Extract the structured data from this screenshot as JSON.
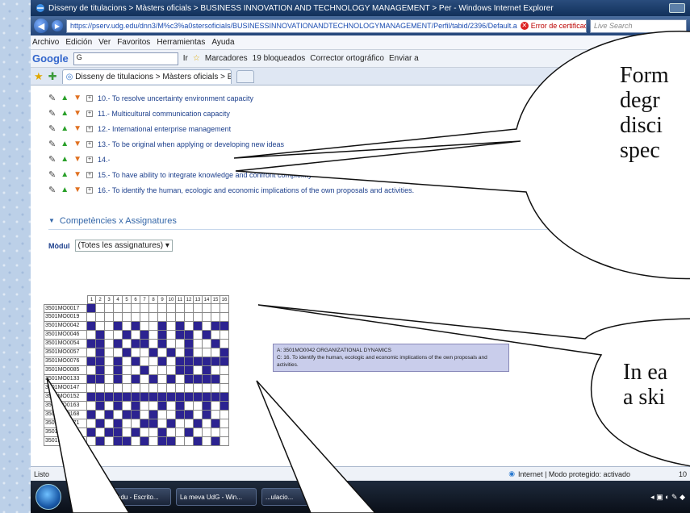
{
  "window": {
    "title": "Disseny de titulacions > Màsters oficials > BUSINESS INNOVATION AND TECHNOLOGY MANAGEMENT > Per - Windows Internet Explorer",
    "url": "https://pserv.udg.edu/dnn3/M%c3%a0stersoficials/BUSINESSINNOVATIONANDTECHNOLOGYMANAGEMENT/Perfil/tabid/2396/Default.a",
    "cert_error": "Error de certificado",
    "live_search": "Live Search"
  },
  "menu": [
    "Archivo",
    "Edición",
    "Ver",
    "Favoritos",
    "Herramientas",
    "Ayuda"
  ],
  "google_bar": {
    "logo": "Google",
    "search_value": "G",
    "go": "Ir",
    "bookmarks": "Marcadores",
    "blocked": "19 bloqueados",
    "spell": "Corrector ortográfico",
    "send": "Enviar a"
  },
  "tab": {
    "label": "Disseny de titulacions > Màsters oficials > BUSIN..."
  },
  "competences": [
    "10.- To resolve uncertainty environment capacity",
    "11.- Multicultural communication capacity",
    "12.- International enterprise management",
    "13.- To be original when applying or developing new ideas",
    "14.-",
    "15.- To have ability to integrate knowledge and confront complexity",
    "16.- To identify the human, ecologic and economic implications of the own proposals and activities."
  ],
  "section": {
    "title": "Competències x Assignatures"
  },
  "modul": {
    "label": "Mòdul",
    "value": "(Totes les assignatures)"
  },
  "matrix": {
    "columns": [
      "1",
      "2",
      "3",
      "4",
      "5",
      "6",
      "7",
      "8",
      "9",
      "10",
      "11",
      "12",
      "13",
      "14",
      "15",
      "16"
    ],
    "rows": [
      {
        "code": "3501MO0017",
        "cells": [
          1,
          0,
          0,
          0,
          0,
          0,
          0,
          0,
          0,
          0,
          0,
          0,
          0,
          0,
          0,
          0
        ]
      },
      {
        "code": "3501MO0019",
        "cells": [
          0,
          0,
          0,
          0,
          0,
          0,
          0,
          0,
          0,
          0,
          0,
          0,
          0,
          0,
          0,
          0
        ]
      },
      {
        "code": "3501MO0042",
        "cells": [
          1,
          0,
          0,
          1,
          0,
          1,
          0,
          0,
          1,
          0,
          1,
          0,
          1,
          0,
          1,
          1
        ]
      },
      {
        "code": "3501MO0046",
        "cells": [
          0,
          1,
          0,
          0,
          1,
          0,
          1,
          0,
          1,
          0,
          1,
          1,
          0,
          1,
          0,
          0
        ]
      },
      {
        "code": "3501MO0054",
        "cells": [
          1,
          1,
          0,
          1,
          0,
          1,
          1,
          0,
          1,
          0,
          0,
          1,
          0,
          0,
          1,
          0
        ]
      },
      {
        "code": "3501MO0057",
        "cells": [
          0,
          1,
          0,
          0,
          1,
          0,
          0,
          1,
          0,
          1,
          0,
          1,
          0,
          0,
          0,
          1
        ]
      },
      {
        "code": "3501MO0076",
        "cells": [
          1,
          1,
          0,
          1,
          0,
          1,
          0,
          0,
          1,
          0,
          1,
          1,
          1,
          1,
          1,
          1
        ]
      },
      {
        "code": "3501MO0085",
        "cells": [
          0,
          1,
          0,
          1,
          0,
          0,
          1,
          0,
          0,
          0,
          1,
          1,
          0,
          1,
          0,
          0
        ]
      },
      {
        "code": "3501MO0133",
        "cells": [
          1,
          1,
          0,
          1,
          0,
          1,
          0,
          1,
          0,
          1,
          0,
          1,
          1,
          1,
          1,
          0
        ]
      },
      {
        "code": "3501MO0147",
        "cells": [
          0,
          0,
          0,
          0,
          0,
          0,
          0,
          0,
          0,
          0,
          0,
          0,
          0,
          0,
          0,
          0
        ]
      },
      {
        "code": "3501MO0152",
        "cells": [
          1,
          1,
          1,
          1,
          1,
          1,
          1,
          1,
          1,
          1,
          1,
          1,
          1,
          1,
          1,
          1
        ]
      },
      {
        "code": "3501MO0163",
        "cells": [
          0,
          1,
          0,
          1,
          0,
          1,
          0,
          0,
          1,
          0,
          1,
          0,
          0,
          1,
          0,
          1
        ]
      },
      {
        "code": "3501MO0168",
        "cells": [
          1,
          0,
          1,
          0,
          1,
          1,
          0,
          1,
          0,
          0,
          1,
          1,
          0,
          1,
          0,
          0
        ]
      },
      {
        "code": "3501MO0171",
        "cells": [
          0,
          1,
          0,
          1,
          0,
          0,
          1,
          1,
          0,
          1,
          0,
          0,
          1,
          0,
          1,
          0
        ]
      },
      {
        "code": "3501MO0175",
        "cells": [
          1,
          0,
          1,
          1,
          0,
          1,
          0,
          0,
          1,
          0,
          0,
          1,
          0,
          0,
          0,
          0
        ]
      },
      {
        "code": "3501MO0180",
        "cells": [
          0,
          1,
          0,
          1,
          1,
          0,
          1,
          0,
          1,
          1,
          0,
          0,
          1,
          0,
          1,
          0
        ]
      }
    ]
  },
  "tooltip": {
    "line1": "A: 3501MO0042 ORGANIZATIONAL DYNAMICS",
    "line2": "C: 16. To identify the human, ecologic and economic implications of the own proposals and activities."
  },
  "status": {
    "left": "Listo",
    "zone": "Internet | Modo protegido: activado",
    "zoom": "10"
  },
  "taskbar": [
    "tss.udg.edu - Escrito...",
    "La meva UdG - Win...",
    "...ulacio..."
  ],
  "bubbles": {
    "top": [
      "Form",
      "degr",
      "disci",
      "spec"
    ],
    "bottom": [
      "In ea",
      "a ski"
    ]
  }
}
